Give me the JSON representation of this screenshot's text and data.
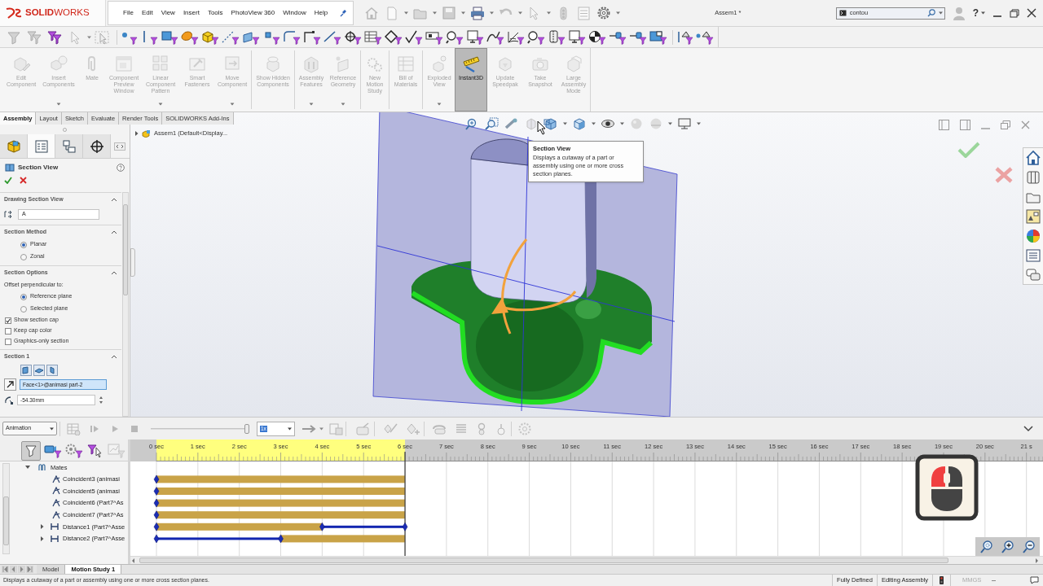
{
  "title_bar": {
    "logo": "**SOLID**WORKS",
    "menu": [
      "File",
      "Edit",
      "View",
      "Insert",
      "Tools",
      "PhotoView 360",
      "Window",
      "Help"
    ],
    "document_title": "Assem1 *",
    "search": {
      "value": "contou"
    },
    "help": "?"
  },
  "ribbon": {
    "buttons": [
      {
        "label": "Edit Component",
        "disabled": true,
        "selected": false,
        "has_menu": false
      },
      {
        "label": "Insert Components",
        "disabled": true,
        "selected": false,
        "has_menu": true
      },
      {
        "label": "Mate",
        "disabled": true,
        "selected": false,
        "has_menu": false
      },
      {
        "label": "Component Preview Window",
        "disabled": true,
        "selected": false,
        "has_menu": false
      },
      {
        "label": "Linear Component Pattern",
        "disabled": true,
        "selected": false,
        "has_menu": true
      },
      {
        "label": "Smart Fasteners",
        "disabled": true,
        "selected": false,
        "has_menu": false
      },
      {
        "label": "Move Component",
        "disabled": true,
        "selected": false,
        "has_menu": true
      },
      {
        "label": "Show Hidden Components",
        "disabled": true,
        "selected": false,
        "has_menu": false
      },
      {
        "label": "Assembly Features",
        "disabled": true,
        "selected": false,
        "has_menu": true
      },
      {
        "label": "Reference Geometry",
        "disabled": true,
        "selected": false,
        "has_menu": true
      },
      {
        "label": "New Motion Study",
        "disabled": true,
        "selected": false,
        "has_menu": false
      },
      {
        "label": "Bill of Materials",
        "disabled": true,
        "selected": false,
        "has_menu": false
      },
      {
        "label": "Exploded View",
        "disabled": true,
        "selected": false,
        "has_menu": true
      },
      {
        "label": "Instant3D",
        "disabled": false,
        "selected": true,
        "has_menu": false
      },
      {
        "label": "Update Speedpak",
        "disabled": true,
        "selected": false,
        "has_menu": false
      },
      {
        "label": "Take Snapshot",
        "disabled": true,
        "selected": false,
        "has_menu": false
      },
      {
        "label": "Large Assembly Mode",
        "disabled": true,
        "selected": false,
        "has_menu": false
      }
    ]
  },
  "command_tabs": [
    {
      "label": "Assembly",
      "selected": true
    },
    {
      "label": "Layout",
      "selected": false
    },
    {
      "label": "Sketch",
      "selected": false
    },
    {
      "label": "Evaluate",
      "selected": false
    },
    {
      "label": "Render Tools",
      "selected": false
    },
    {
      "label": "SOLIDWORKS Add-Ins",
      "selected": false
    }
  ],
  "property_manager": {
    "panel_tabs": [
      {
        "selected": false
      },
      {
        "selected": true
      },
      {
        "selected": false
      },
      {
        "selected": false
      }
    ],
    "title": "Section View",
    "groups": [
      {
        "title": "Drawing Section View",
        "expanded": true,
        "items": [
          {
            "kind": "field",
            "value": "A"
          }
        ]
      },
      {
        "title": "Section Method",
        "expanded": true,
        "items": [
          {
            "kind": "radio",
            "label": "Planar",
            "selected": true
          },
          {
            "kind": "radio",
            "label": "Zonal",
            "selected": false
          }
        ]
      },
      {
        "title": "Section Options",
        "expanded": true,
        "items": [
          {
            "kind": "text",
            "label": "Offset perpendicular to:"
          },
          {
            "kind": "radio",
            "label": "Reference plane",
            "selected": true
          },
          {
            "kind": "radio",
            "label": "Selected plane",
            "selected": false
          },
          {
            "kind": "checkbox",
            "label": "Show section cap",
            "checked": true
          },
          {
            "kind": "checkbox",
            "label": "Keep cap color",
            "checked": false
          },
          {
            "kind": "checkbox",
            "label": "Graphics-only section",
            "checked": false
          }
        ]
      },
      {
        "title": "Section 1",
        "expanded": true,
        "items": [
          {
            "kind": "icon_buttons"
          },
          {
            "kind": "selection",
            "value": "Face<1>@animasi part-2"
          },
          {
            "kind": "number",
            "value": "-54.30mm"
          }
        ]
      }
    ]
  },
  "viewport": {
    "feature_tree": {
      "label": "Assem1 (Default<Display...",
      "expanded": false
    },
    "tooltip": {
      "title": "Section View",
      "text": "Displays a cutaway of a part or assembly using one or more cross section planes."
    }
  },
  "motion_manager": {
    "study_type": "Animation",
    "time_slider": {
      "level": 0.98
    },
    "playback_speed": "1x",
    "tree": {
      "label": "Mates",
      "expanded": true,
      "children": [
        {
          "kind": "coincident"
        },
        {
          "kind": "coincident"
        },
        {
          "kind": "coincident"
        },
        {
          "kind": "coincident"
        },
        {
          "kind": "distance"
        },
        {
          "kind": "distance"
        }
      ]
    },
    "chart_data": {
      "type": "bar",
      "orientation": "horizontal",
      "stacked": true,
      "grid": true,
      "categories": [
        "Coincident3 (animasi",
        "Coincident5 (animasi",
        "Coincident6 (Part7^As",
        "Coincident7 (Part7^As",
        "Distance1 (Part7^Asse",
        "Distance2 (Part7^Asse"
      ],
      "series": [
        {
          "color": "#c9a348",
          "values": [
            6,
            6,
            6,
            6,
            4,
            0
          ]
        },
        {
          "color": "#1226b0",
          "values": [
            0,
            0,
            0,
            0,
            2,
            3
          ]
        },
        {
          "color": "#c9a348",
          "values": [
            0,
            0,
            0,
            0,
            0,
            3
          ]
        }
      ],
      "xlim": [
        0,
        21.4
      ],
      "xticks": [
        {
          "value": 0,
          "label": "0 sec"
        },
        {
          "value": 1,
          "label": "1 sec"
        },
        {
          "value": 2,
          "label": "2 sec"
        },
        {
          "value": 3,
          "label": "3 sec"
        },
        {
          "value": 4,
          "label": "4 sec"
        },
        {
          "value": 5,
          "label": "5 sec"
        },
        {
          "value": 6,
          "label": "6 sec"
        },
        {
          "value": 7,
          "label": "7 sec"
        },
        {
          "value": 8,
          "label": "8 sec"
        },
        {
          "value": 9,
          "label": "9 sec"
        },
        {
          "value": 10,
          "label": "10 sec"
        },
        {
          "value": 11,
          "label": "11 sec"
        },
        {
          "value": 12,
          "label": "12 sec"
        },
        {
          "value": 13,
          "label": "13 sec"
        },
        {
          "value": 14,
          "label": "14 sec"
        },
        {
          "value": 15,
          "label": "15 sec"
        },
        {
          "value": 16,
          "label": "16 sec"
        },
        {
          "value": 17,
          "label": "17 sec"
        },
        {
          "value": 18,
          "label": "18 sec"
        },
        {
          "value": 19,
          "label": "19 sec"
        },
        {
          "value": 20,
          "label": "20 sec"
        },
        {
          "value": 21,
          "label": "21 s"
        }
      ],
      "ref_lines": [
        {
          "axis": "x",
          "value": 6
        }
      ]
    }
  },
  "bottom_tabs": [
    {
      "label": "Model",
      "selected": false
    },
    {
      "label": "Motion Study 1",
      "selected": true
    }
  ],
  "status_bar": {
    "message": "Displays a cutaway of a part or assembly using one or more cross section planes.",
    "indicators": [
      "Fully Defined",
      "Editing Assembly"
    ],
    "units": "MMGS"
  }
}
